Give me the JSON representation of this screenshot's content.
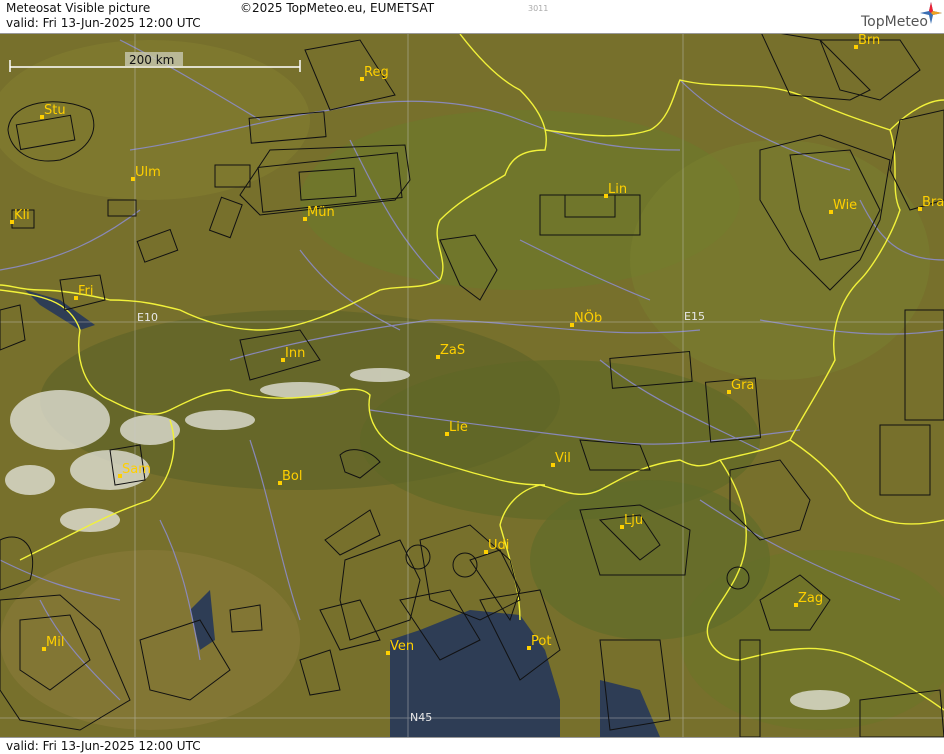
{
  "header": {
    "title": "Meteosat Visible picture",
    "valid": "valid:  Fri  13-Jun-2025  12:00 UTC",
    "copyright": "©2025 TopMeteo.eu, EUMETSAT",
    "code": "3011",
    "brand": "TopMeteo"
  },
  "footer": {
    "valid": "valid:  Fri  13-Jun-2025  12:00 UTC"
  },
  "scale": {
    "label": "200 km"
  },
  "grid_labels": {
    "e10": "E10",
    "e15": "E15",
    "n45": "N45"
  },
  "cities": [
    {
      "name": "Reg"
    },
    {
      "name": "Brn"
    },
    {
      "name": "Stu"
    },
    {
      "name": "Ulm"
    },
    {
      "name": "Mün"
    },
    {
      "name": "Lin"
    },
    {
      "name": "Wie"
    },
    {
      "name": "Bra"
    },
    {
      "name": "Kli"
    },
    {
      "name": "Fri"
    },
    {
      "name": "NÖb"
    },
    {
      "name": "ZaS"
    },
    {
      "name": "Inn"
    },
    {
      "name": "Gra"
    },
    {
      "name": "Lie"
    },
    {
      "name": "Vil"
    },
    {
      "name": "Sam"
    },
    {
      "name": "Bol"
    },
    {
      "name": "Lju"
    },
    {
      "name": "Udi"
    },
    {
      "name": "Zag"
    },
    {
      "name": "Mil"
    },
    {
      "name": "Ven"
    },
    {
      "name": "Pot"
    }
  ],
  "colors": {
    "land": "#7a6a2a",
    "border": "#f2f23a",
    "city": "#ffd000",
    "river": "#8c8cc8",
    "sea": "#2e3d55"
  }
}
